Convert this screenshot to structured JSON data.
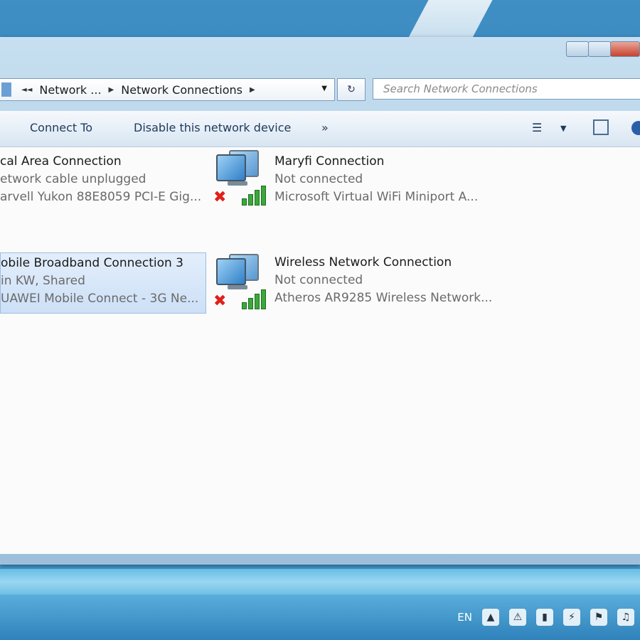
{
  "address": {
    "crumbs": [
      "Network ...",
      "Network Connections"
    ],
    "refresh_icon": "refresh-icon"
  },
  "search": {
    "placeholder": "Search Network Connections"
  },
  "toolbar": {
    "connect_to": "Connect To",
    "disable_device": "Disable this network device",
    "more_icon": "overflow-chevron-icon"
  },
  "connections": [
    {
      "name": "cal Area Connection",
      "status": "etwork cable unplugged",
      "device": "arvell Yukon 88E8059 PCI-E Gig...",
      "selected": false
    },
    {
      "name": "Maryfi Connection",
      "status": "Not connected",
      "device": "Microsoft Virtual WiFi Miniport A...",
      "selected": false
    },
    {
      "name": "obile Broadband Connection 3",
      "status": "in KW, Shared",
      "device": "UAWEI Mobile Connect - 3G Ne...",
      "selected": true
    },
    {
      "name": "Wireless Network Connection",
      "status": "Not connected",
      "device": "Atheros AR9285 Wireless Network...",
      "selected": false
    }
  ],
  "taskbar": {
    "language": "EN"
  },
  "colors": {
    "accent": "#3b8ec2",
    "error": "#e0201a",
    "signal": "#3aa83a"
  }
}
